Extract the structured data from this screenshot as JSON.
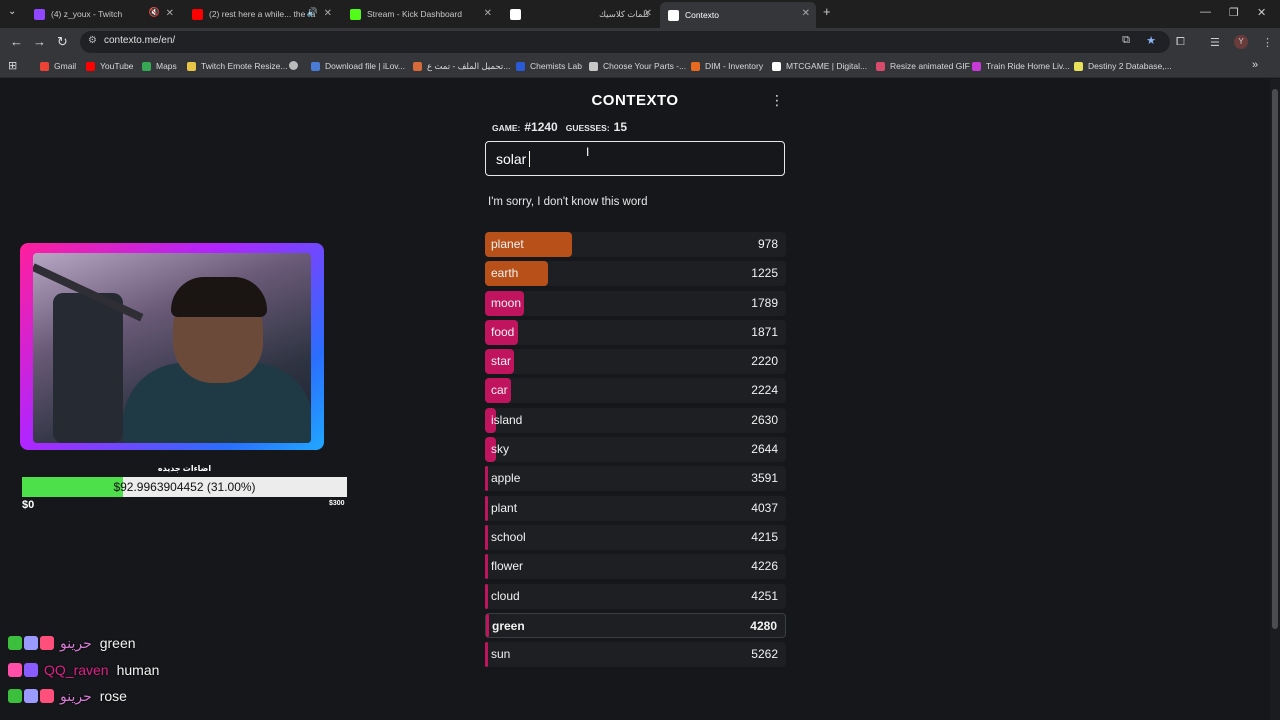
{
  "browser": {
    "tabs": [
      {
        "label": "(4) z_youx - Twitch",
        "icon_color": "#9146ff",
        "muted": true
      },
      {
        "label": "(2) rest here a while... the ra",
        "icon_color": "#ff0000",
        "audio": true
      },
      {
        "label": "Stream - Kick Dashboard",
        "icon_color": "#53fc18"
      },
      {
        "label": "كلمات كلاسيك",
        "icon_color": "#ffffff"
      },
      {
        "label": "Contexto",
        "icon_color": "#ffffff",
        "active": true
      }
    ],
    "url": "contexto.me/en/",
    "bookmarks": [
      {
        "label": "Gmail",
        "color": "#ea4335"
      },
      {
        "label": "YouTube",
        "color": "#ff0000"
      },
      {
        "label": "Maps",
        "color": "#34a853"
      },
      {
        "label": "Twitch Emote Resize...",
        "color": "#e8c547"
      },
      {
        "label": "",
        "color": "#bbbbbb"
      },
      {
        "label": "Download file | iLov...",
        "color": "#4a7bd6"
      },
      {
        "label": "تحميل الملف - تمت ع...",
        "color": "#d66a3a"
      },
      {
        "label": "Chemists Lab",
        "color": "#2a5bd6"
      },
      {
        "label": "Choose Your Parts -...",
        "color": "#c8c8c8"
      },
      {
        "label": "DIM - Inventory",
        "color": "#e86a1e"
      },
      {
        "label": "MTCGAME | Digital...",
        "color": "#ffffff"
      },
      {
        "label": "Resize animated GIF",
        "color": "#d84a6a"
      },
      {
        "label": "Train Ride Home Liv...",
        "color": "#c83ad6"
      },
      {
        "label": "Destiny 2 Database,...",
        "color": "#e8e15a"
      }
    ]
  },
  "game": {
    "logo": "CONTEXTO",
    "game_label": "GAME:",
    "game_number": "#1240",
    "guesses_label": "GUESSES:",
    "guesses_count": "15",
    "input_value": "solar",
    "message": "I'm sorry, I don't know this word",
    "guesses": [
      {
        "word": "planet",
        "distance": "978",
        "color": "#b8501a",
        "fill": 0.29
      },
      {
        "word": "earth",
        "distance": "1225",
        "color": "#b8501a",
        "fill": 0.21
      },
      {
        "word": "moon",
        "distance": "1789",
        "color": "#c0155e",
        "fill": 0.13
      },
      {
        "word": "food",
        "distance": "1871",
        "color": "#c0155e",
        "fill": 0.11
      },
      {
        "word": "star",
        "distance": "2220",
        "color": "#c0155e",
        "fill": 0.095
      },
      {
        "word": "car",
        "distance": "2224",
        "color": "#c0155e",
        "fill": 0.085
      },
      {
        "word": "island",
        "distance": "2630",
        "color": "#c0155e",
        "fill": 0.035
      },
      {
        "word": "sky",
        "distance": "2644",
        "color": "#c0155e",
        "fill": 0.035
      },
      {
        "word": "apple",
        "distance": "3591",
        "color": "#c0155e",
        "fill": 0.008
      },
      {
        "word": "plant",
        "distance": "4037",
        "color": "#c0155e",
        "fill": 0.008
      },
      {
        "word": "school",
        "distance": "4215",
        "color": "#c0155e",
        "fill": 0.008
      },
      {
        "word": "flower",
        "distance": "4226",
        "color": "#c0155e",
        "fill": 0.008
      },
      {
        "word": "cloud",
        "distance": "4251",
        "color": "#c0155e",
        "fill": 0.008
      },
      {
        "word": "green",
        "distance": "4280",
        "color": "#c0155e",
        "fill": 0.008,
        "current": true
      },
      {
        "word": "sun",
        "distance": "5262",
        "color": "#c0155e",
        "fill": 0.008
      }
    ]
  },
  "overlay": {
    "goal_title": "اضاءات جديده",
    "goal_text": "$92.9963904452 (31.00%)",
    "goal_progress": 0.31,
    "goal_min": "$0",
    "goal_max": "$300",
    "chat": [
      {
        "user": "حرينو",
        "user_color": "#d77bd6",
        "message": "green",
        "badges": [
          "#3cbf3c",
          "#9a9aff",
          "#ff4f7a"
        ]
      },
      {
        "user": "QQ_raven",
        "user_color": "#e0208a",
        "message": "human",
        "badges": [
          "#ff4fa8",
          "#8a5cff"
        ]
      },
      {
        "user": "حرينو",
        "user_color": "#d77bd6",
        "message": "rose",
        "badges": [
          "#3cbf3c",
          "#9a9aff",
          "#ff4f7a"
        ]
      }
    ]
  }
}
